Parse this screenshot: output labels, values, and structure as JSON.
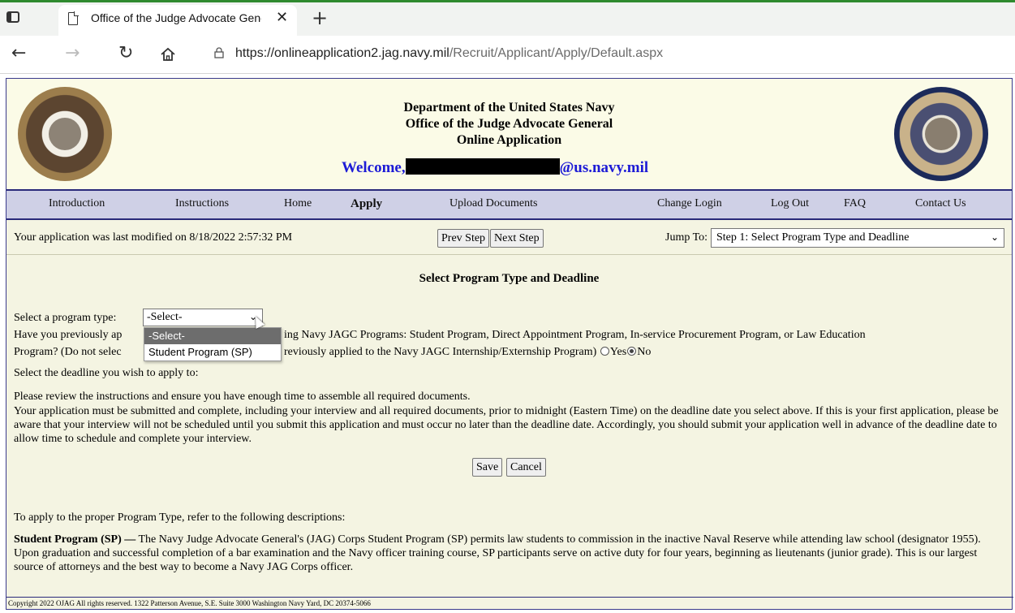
{
  "browser": {
    "tab_title": "Office of the Judge Advocate General Online Application",
    "close_glyph": "✕",
    "newtab_glyph": "+",
    "url_host": "https://onlineapplication2.jag.navy.mil",
    "url_path": "/Recruit/Applicant/Apply/Default.aspx",
    "icons": [
      "sidebar-icon",
      "page-icon",
      "close-icon",
      "back-icon",
      "forward-icon",
      "refresh-icon",
      "home-icon",
      "lock-icon"
    ]
  },
  "header": {
    "line1": "Department of the United States Navy",
    "line2": "Office of the Judge Advocate General",
    "line3": "Online Application",
    "welcome_prefix": "Welcome,",
    "welcome_suffix": "@us.navy.mil"
  },
  "menu": {
    "introduction": "Introduction",
    "instructions": "Instructions",
    "home": "Home",
    "apply": "Apply",
    "upload": "Upload Documents",
    "change_login": "Change Login",
    "logout": "Log Out",
    "faq": "FAQ",
    "contact": "Contact Us"
  },
  "status": {
    "modified": "Your application was last modified on 8/18/2022 2:57:32 PM",
    "prev": "Prev Step",
    "next": "Next Step",
    "jump_label": "Jump To:",
    "jump_value": "Step 1: Select Program Type and Deadline"
  },
  "form": {
    "title": "Select Program Type and Deadline",
    "program_label": "Select a program type:",
    "program_value": "-Select-",
    "options": [
      "-Select-",
      "Student Program (SP)"
    ],
    "prev_q_a": "Have you previously ap",
    "prev_q_b": "ing Navy JAGC Programs: Student Program, Direct Appointment Program, In-service Procurement Program, or Law Education",
    "prev_q_c": "Program? (Do not selec",
    "prev_q_d": "reviously applied to the Navy JAGC Internship/Externship Program)",
    "yes": "Yes",
    "no": "No",
    "deadline_label": "Select the deadline you wish to apply to:",
    "review": "Please review the instructions and ensure you have enough time to assemble all required documents.",
    "submit_note": "Your application must be submitted and complete, including your interview and all required documents, prior to midnight (Eastern Time) on the deadline date you select above. If this is your first application, please be aware that your interview will not be scheduled until you submit this application and must occur no later than the deadline date. Accordingly, you should submit your application well in advance of the deadline date to allow time to schedule and complete your interview.",
    "save": "Save",
    "cancel": "Cancel"
  },
  "descriptions": {
    "intro": "To apply to the proper Program Type, refer to the following descriptions:",
    "sp_title": "Student Program (SP) —",
    "sp_text": " The Navy Judge Advocate General's (JAG) Corps Student Program (SP) permits law students to commission in the inactive Naval Reserve while attending law school (designator 1955). Upon graduation and successful completion of a bar examination and the Navy officer training course, SP participants serve on active duty for four years, beginning as lieutenants (junior grade). This is our largest source of attorneys and the best way to become a Navy JAG Corps officer."
  },
  "footer": {
    "text": "Copyright 2022 OJAG All rights reserved. 1322 Patterson Avenue, S.E. Suite 3000 Washington Navy Yard, DC 20374-5066"
  },
  "colors": {
    "page_bg": "#f4f4e2",
    "menu_bg": "#cfd0e6",
    "border_navy": "#2a2a7a",
    "welcome_blue": "#1d1bd6"
  }
}
